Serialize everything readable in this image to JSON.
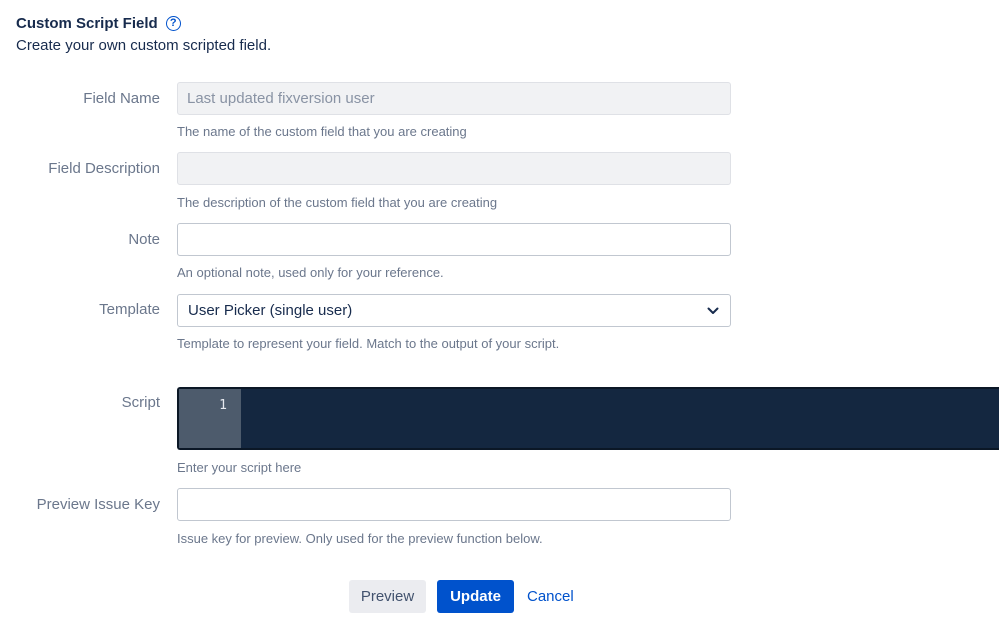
{
  "header": {
    "title": "Custom Script Field",
    "help_icon": "question-circle-icon",
    "subtitle": "Create your own custom scripted field."
  },
  "form": {
    "field_name": {
      "label": "Field Name",
      "value": "Last updated fixversion user",
      "help": "The name of the custom field that you are creating"
    },
    "field_description": {
      "label": "Field Description",
      "value": "",
      "help": "The description of the custom field that you are creating"
    },
    "note": {
      "label": "Note",
      "value": "",
      "help": "An optional note, used only for your reference."
    },
    "template": {
      "label": "Template",
      "selected": "User Picker (single user)",
      "help": "Template to represent your field. Match to the output of your script."
    },
    "script": {
      "label": "Script",
      "line_number": "1",
      "help": "Enter your script here"
    },
    "preview_issue_key": {
      "label": "Preview Issue Key",
      "value": "",
      "help": "Issue key for preview. Only used for the preview function below."
    }
  },
  "actions": {
    "preview_label": "Preview",
    "update_label": "Update",
    "cancel_label": "Cancel"
  },
  "colors": {
    "primary": "#0052cc",
    "editor_bg": "#142740",
    "gutter_bg": "#4d5b6c"
  }
}
